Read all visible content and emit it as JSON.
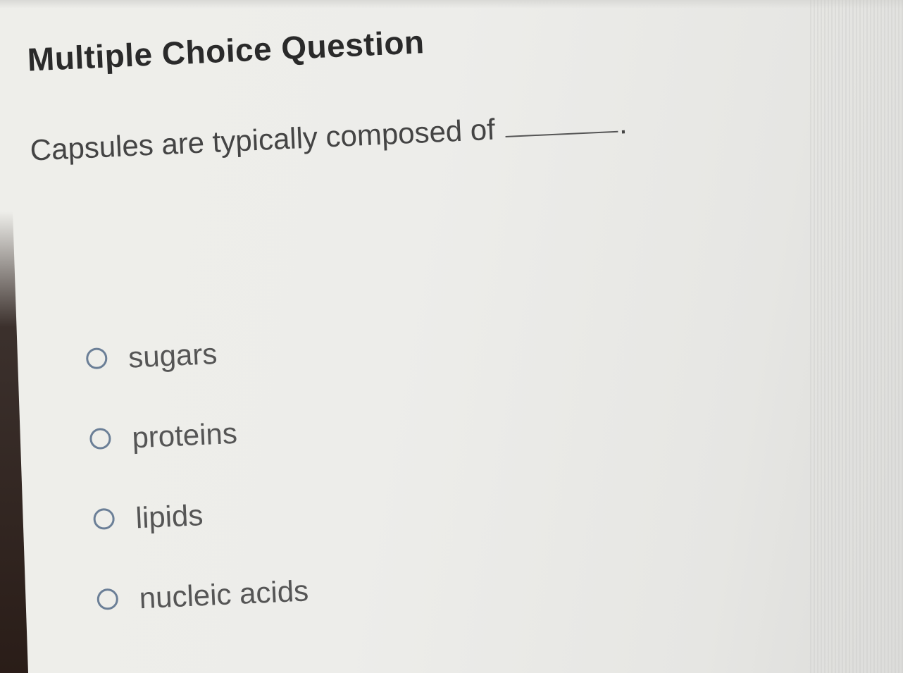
{
  "header": {
    "title": "Multiple Choice Question"
  },
  "question": {
    "text": "Capsules are typically composed of",
    "blank_suffix": "."
  },
  "options": [
    {
      "label": "sugars",
      "selected": false
    },
    {
      "label": "proteins",
      "selected": false
    },
    {
      "label": "lipids",
      "selected": false
    },
    {
      "label": "nucleic acids",
      "selected": false
    }
  ],
  "colors": {
    "radio_border": "#6b7f97",
    "title_text": "#2a2a2a",
    "body_text": "#555555"
  }
}
